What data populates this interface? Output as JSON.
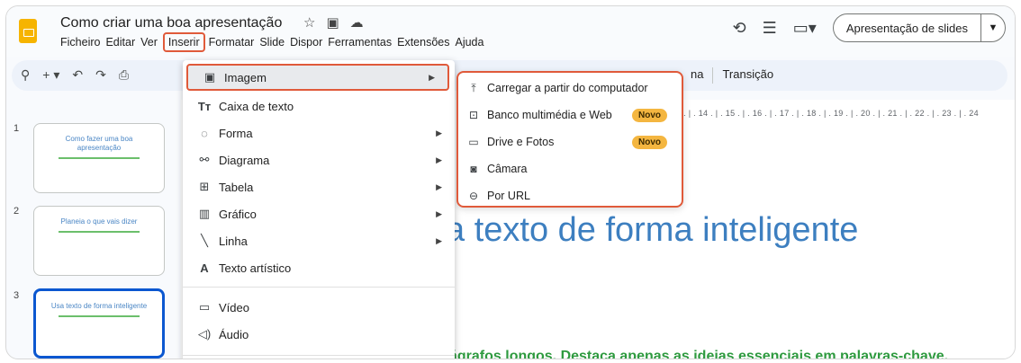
{
  "header": {
    "title": "Como criar uma boa apresentação",
    "menu": [
      "Ficheiro",
      "Editar",
      "Ver",
      "Inserir",
      "Formatar",
      "Slide",
      "Dispor",
      "Ferramentas",
      "Extensões",
      "Ajuda"
    ],
    "present_label": "Apresentação de slides"
  },
  "toolbar": {
    "right_partial": "na",
    "transition_label": "Transição"
  },
  "ruler": "3 . | . 14 . | . 15 . | . 16 . | . 17 . | . 18 . | . 19 . | . 20 . | . 21 . | . 22 . | . 23 . | . 24",
  "slides": [
    {
      "number": "1",
      "title": "Como fazer uma boa apresentação"
    },
    {
      "number": "2",
      "title": "Planeia o que vais dizer"
    },
    {
      "number": "3",
      "title": "Usa texto de forma inteligente"
    }
  ],
  "canvas": {
    "title": "a texto de forma inteligente",
    "body": "ágrafos longos. Destaca apenas as ideias essenciais em palavras-chave."
  },
  "insert_menu": {
    "items": [
      {
        "icon": "image-icon",
        "label": "Imagem",
        "submenu": true
      },
      {
        "icon": "text-box-icon",
        "label": "Caixa de texto",
        "submenu": false
      },
      {
        "icon": "shape-icon",
        "label": "Forma",
        "submenu": true
      },
      {
        "icon": "diagram-icon",
        "label": "Diagrama",
        "submenu": true
      },
      {
        "icon": "table-icon",
        "label": "Tabela",
        "submenu": true
      },
      {
        "icon": "chart-icon",
        "label": "Gráfico",
        "submenu": true
      },
      {
        "icon": "line-icon",
        "label": "Linha",
        "submenu": true
      },
      {
        "icon": "word-art-icon",
        "label": "Texto artístico",
        "submenu": false
      },
      {
        "icon": "video-icon",
        "label": "Vídeo",
        "submenu": false
      },
      {
        "icon": "audio-icon",
        "label": "Áudio",
        "submenu": false
      }
    ]
  },
  "image_submenu": {
    "items": [
      {
        "icon": "upload-icon",
        "label": "Carregar a partir do computador",
        "badge": ""
      },
      {
        "icon": "media-bank-icon",
        "label": "Banco multimédia e Web",
        "badge": "Novo"
      },
      {
        "icon": "folder-icon",
        "label": "Drive e Fotos",
        "badge": "Novo"
      },
      {
        "icon": "camera-icon",
        "label": "Câmara",
        "badge": ""
      },
      {
        "icon": "link-icon",
        "label": "Por URL",
        "badge": ""
      }
    ]
  },
  "colors": {
    "highlight": "#e05a3a",
    "badge": "#f4b640",
    "title_blue": "#3d7fc0",
    "body_green": "#2e9a3f",
    "selected_slide": "#0b57d0"
  }
}
